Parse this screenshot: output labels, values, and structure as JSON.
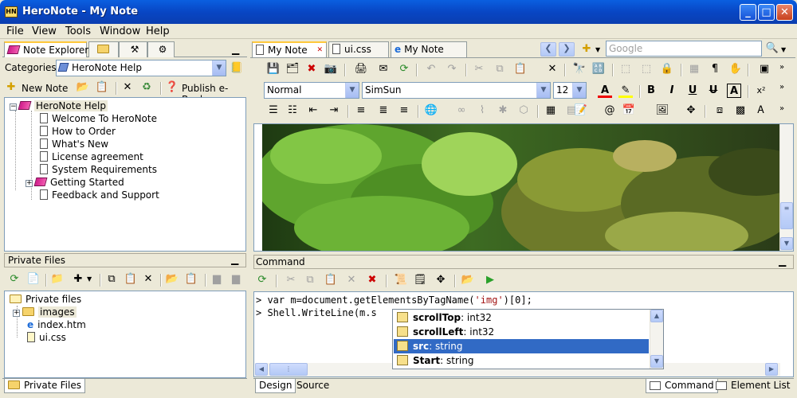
{
  "window": {
    "title": "HeroNote - My Note",
    "icon_text": "HN",
    "min": "_",
    "max": "□",
    "close": "✕"
  },
  "menu": [
    "File",
    "View",
    "Tools",
    "Window",
    "Help"
  ],
  "left_tabs": {
    "note_explorer": "Note Explorer"
  },
  "categories": {
    "label": "Categories:",
    "value": "HeroNote Help"
  },
  "left_toolbar": {
    "new_note": "New Note",
    "publish": "Publish e-Book"
  },
  "note_tree": {
    "root": "HeroNote Help",
    "items": [
      "Welcome To HeroNote",
      "How to Order",
      "What's New",
      "License agreement",
      "System Requirements",
      "Getting Started",
      "Feedback and Support"
    ]
  },
  "private_files": {
    "title": "Private Files",
    "root": "Private files",
    "items": [
      "images",
      "index.htm",
      "ui.css"
    ],
    "tab": "Private Files"
  },
  "doc_tabs": [
    "My Note",
    "ui.css",
    "My Note"
  ],
  "search": {
    "placeholder": "Google"
  },
  "format": {
    "style": "Normal",
    "font": "SimSun",
    "size": "12"
  },
  "command": {
    "title": "Command",
    "line1_pre": "> var m=document.getElementsByTagName(",
    "line1_str": "'img'",
    "line1_post": ")[0];",
    "line2": "> Shell.WriteLine(m.s"
  },
  "autocomplete": [
    {
      "name": "scrollTop",
      "type": ": int32"
    },
    {
      "name": "scrollLeft",
      "type": ": int32"
    },
    {
      "name": "src",
      "type": ": string"
    },
    {
      "name": "Start",
      "type": ": string"
    }
  ],
  "bottom_tabs": {
    "design": "Design",
    "source": "Source",
    "command": "Command",
    "element_list": "Element List"
  }
}
